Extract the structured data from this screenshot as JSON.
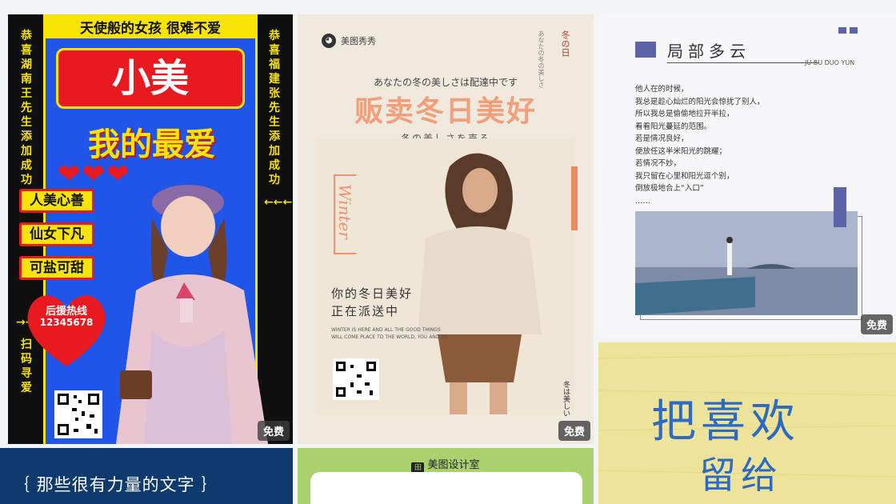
{
  "badge_free": "免费",
  "card1": {
    "top_text": "天使般的女孩 很难不爱",
    "side_left": "恭喜湖南王先生添加成功",
    "side_right": "恭喜福建张先生添加成功",
    "arrows_right": "←←←←←",
    "arrows_left": "→→→→→",
    "side_bottom": "扫码寻爱",
    "title": "小美",
    "subtitle": "我的最爱",
    "hearts": "❤❤❤",
    "tags": [
      "人美心善",
      "仙女下凡",
      "可盐可甜"
    ],
    "hotline_label": "后援热线",
    "hotline_number": "12345678",
    "colors": {
      "yellow": "#f7e400",
      "blue": "#1f55e8",
      "red": "#e8191f"
    }
  },
  "card2": {
    "brand": "美图秀秀",
    "vert_1": "冬の日",
    "vert_2": "あなたの冬の美しさ",
    "jp_line1": "あなたの冬の美しさは配達中です",
    "headline": "贩卖冬日美好",
    "jp_line2": "冬の美しさを売る",
    "winter": "Winter",
    "poem_line1": "你的冬日美好",
    "poem_line2": "正在派送中",
    "small_text": "WINTER IS HERE AND ALL THE GOOD THINGS WILL COME PLACE TO THE WORLD, YOU AND ME",
    "vert_bottom": "冬は美しい"
  },
  "card3": {
    "title": "局部多云",
    "subtitle_en": "JU BU DUO YUN",
    "lines": [
      "他人在的时候，",
      "我总是趁心灿烂的阳光会惊扰了别人，",
      "所以我总是偷偷地拉开半拉，",
      "看看阳光蔓延的范围。",
      "若是情况良好，",
      "便放任这半米阳光的跳耀；",
      "若情况不妙，",
      "我只留在心里和阳光逗个别，",
      "倒放极地合上“入口”",
      "……"
    ]
  },
  "card4": {
    "title": "｛ 那些很有力量的文字 ｝"
  },
  "card5": {
    "brand_icon": "田",
    "brand": "美图设计室"
  },
  "card6": {
    "line1": "把喜欢",
    "line2": "留给"
  }
}
